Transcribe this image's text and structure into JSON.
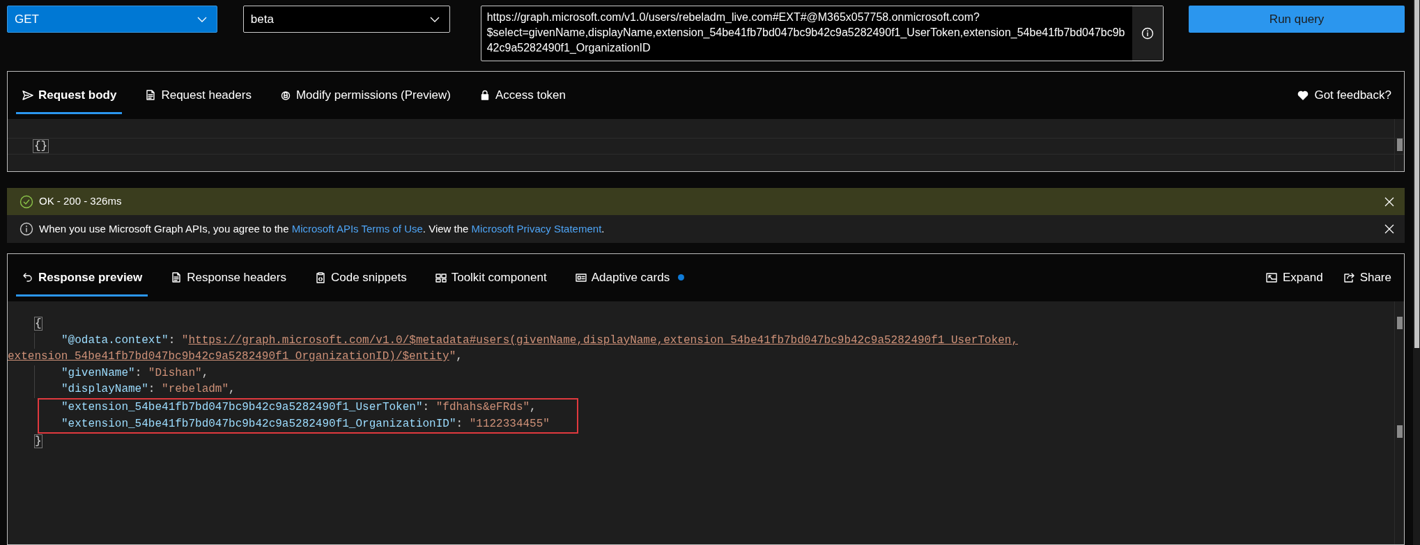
{
  "method": {
    "value": "GET"
  },
  "version": {
    "value": "beta"
  },
  "url": {
    "value": "https://graph.microsoft.com/v1.0/users/rebeladm_live.com#EXT#@M365x057758.onmicrosoft.com?$select=givenName,displayName,extension_54be41fb7bd047bc9b42c9a5282490f1_UserToken,extension_54be41fb7bd047bc9b42c9a5282490f1_OrganizationID"
  },
  "run_button": {
    "label": "Run query"
  },
  "request": {
    "tabs": [
      {
        "label": "Request body",
        "selected": true
      },
      {
        "label": "Request headers",
        "selected": false
      },
      {
        "label": "Modify permissions (Preview)",
        "selected": false
      },
      {
        "label": "Access token",
        "selected": false
      }
    ],
    "actions": [
      {
        "label": "Got feedback?"
      }
    ],
    "body": "{}"
  },
  "status": {
    "kind": "success",
    "text": "OK - 200 - 326ms"
  },
  "notice": {
    "segments": [
      {
        "text": "When you use Microsoft Graph APIs, you agree to the ",
        "link": false
      },
      {
        "text": "Microsoft APIs Terms of Use",
        "link": true
      },
      {
        "text": ". View the ",
        "link": false
      },
      {
        "text": "Microsoft Privacy Statement",
        "link": true
      },
      {
        "text": ".",
        "link": false
      }
    ]
  },
  "response": {
    "tabs": [
      {
        "label": "Response preview",
        "selected": true,
        "dot": false
      },
      {
        "label": "Response headers",
        "selected": false,
        "dot": false
      },
      {
        "label": "Code snippets",
        "selected": false,
        "dot": false
      },
      {
        "label": "Toolkit component",
        "selected": false,
        "dot": false
      },
      {
        "label": "Adaptive cards",
        "selected": false,
        "dot": true
      }
    ],
    "actions": [
      {
        "label": "Expand"
      },
      {
        "label": "Share"
      }
    ],
    "lines": [
      {
        "indented": false,
        "highlighted": false,
        "tokens": [
          {
            "kind": "bracket",
            "text": "{"
          }
        ]
      },
      {
        "indented": true,
        "highlighted": false,
        "tokens": [
          {
            "kind": "key",
            "text": "\"@odata.context\""
          },
          {
            "kind": "punct",
            "text": ": "
          },
          {
            "kind": "string",
            "text": "\""
          },
          {
            "kind": "link",
            "text": "https://graph.microsoft.com/v1.0/$metadata#users(givenName,displayName,extension_54be41fb7bd047bc9b42c9a5282490f1_UserToken,"
          }
        ]
      },
      {
        "indented": false,
        "highlighted": false,
        "tokens": [
          {
            "kind": "link",
            "text": "extension_54be41fb7bd047bc9b42c9a5282490f1_OrganizationID)/$entity"
          },
          {
            "kind": "string",
            "text": "\""
          },
          {
            "kind": "punct",
            "text": ","
          }
        ]
      },
      {
        "indented": true,
        "highlighted": false,
        "tokens": [
          {
            "kind": "key",
            "text": "\"givenName\""
          },
          {
            "kind": "punct",
            "text": ": "
          },
          {
            "kind": "string",
            "text": "\"Dishan\""
          },
          {
            "kind": "punct",
            "text": ","
          }
        ]
      },
      {
        "indented": true,
        "highlighted": false,
        "tokens": [
          {
            "kind": "key",
            "text": "\"displayName\""
          },
          {
            "kind": "punct",
            "text": ": "
          },
          {
            "kind": "string",
            "text": "\"rebeladm\""
          },
          {
            "kind": "punct",
            "text": ","
          }
        ]
      },
      {
        "indented": true,
        "highlighted": true,
        "tokens": [
          {
            "kind": "key",
            "text": "\"extension_54be41fb7bd047bc9b42c9a5282490f1_UserToken\""
          },
          {
            "kind": "punct",
            "text": ": "
          },
          {
            "kind": "string",
            "text": "\"fdhahs&eFRds\""
          },
          {
            "kind": "punct",
            "text": ","
          }
        ]
      },
      {
        "indented": true,
        "highlighted": true,
        "tokens": [
          {
            "kind": "key",
            "text": "\"extension_54be41fb7bd047bc9b42c9a5282490f1_OrganizationID\""
          },
          {
            "kind": "punct",
            "text": ": "
          },
          {
            "kind": "string",
            "text": "\"1122334455\""
          }
        ]
      },
      {
        "indented": false,
        "highlighted": false,
        "tokens": [
          {
            "kind": "bracket",
            "text": "}"
          }
        ]
      }
    ]
  }
}
